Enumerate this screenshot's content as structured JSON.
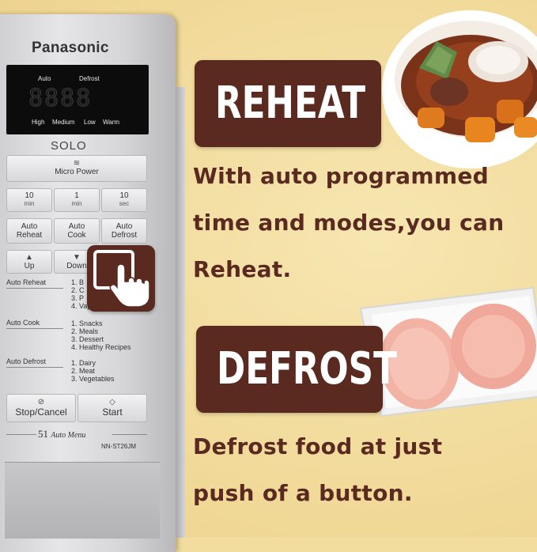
{
  "microwave": {
    "brand": "Panasonic",
    "display": {
      "top_left": "Auto",
      "top_right": "Defrost",
      "digits": "8888",
      "power_levels": [
        "High",
        "Medium",
        "Low",
        "Warm"
      ]
    },
    "series": "SOLO",
    "micro_power": "Micro Power",
    "time_keys": [
      {
        "value": "10",
        "unit": "min"
      },
      {
        "value": "1",
        "unit": "min"
      },
      {
        "value": "10",
        "unit": "sec"
      }
    ],
    "auto_keys": [
      {
        "line1": "Auto",
        "line2": "Reheat"
      },
      {
        "line1": "Auto",
        "line2": "Cook"
      },
      {
        "line1": "Auto",
        "line2": "Defrost"
      }
    ],
    "up_label": "Up",
    "down_label": "Down",
    "auto_reheat": {
      "label": "Auto Reheat",
      "items": "1. B\n2. C\n3. P\n4. Vapor Bcl"
    },
    "auto_cook": {
      "label": "Auto Cook",
      "items": "1. Snacks\n2. Meals\n3. Dessert\n4. Healthy Recipes"
    },
    "auto_defrost": {
      "label": "Auto Defrost",
      "items": "1. Dairy\n2. Meat\n3. Vegetables"
    },
    "stop_label": "Stop/Cancel",
    "start_label": "Start",
    "auto_menu_number": "51",
    "auto_menu_text": "Auto Menu",
    "model": "NN-ST26JM"
  },
  "reheat": {
    "title": "REHEAT",
    "lines": [
      "With auto programmed",
      "time and modes,you can",
      "Reheat."
    ]
  },
  "defrost": {
    "title": "DEFROST",
    "lines": [
      "Defrost food at just",
      "push of a button."
    ]
  },
  "colors": {
    "background": "#f3dd9e",
    "accent_brown": "#5a2a20"
  }
}
